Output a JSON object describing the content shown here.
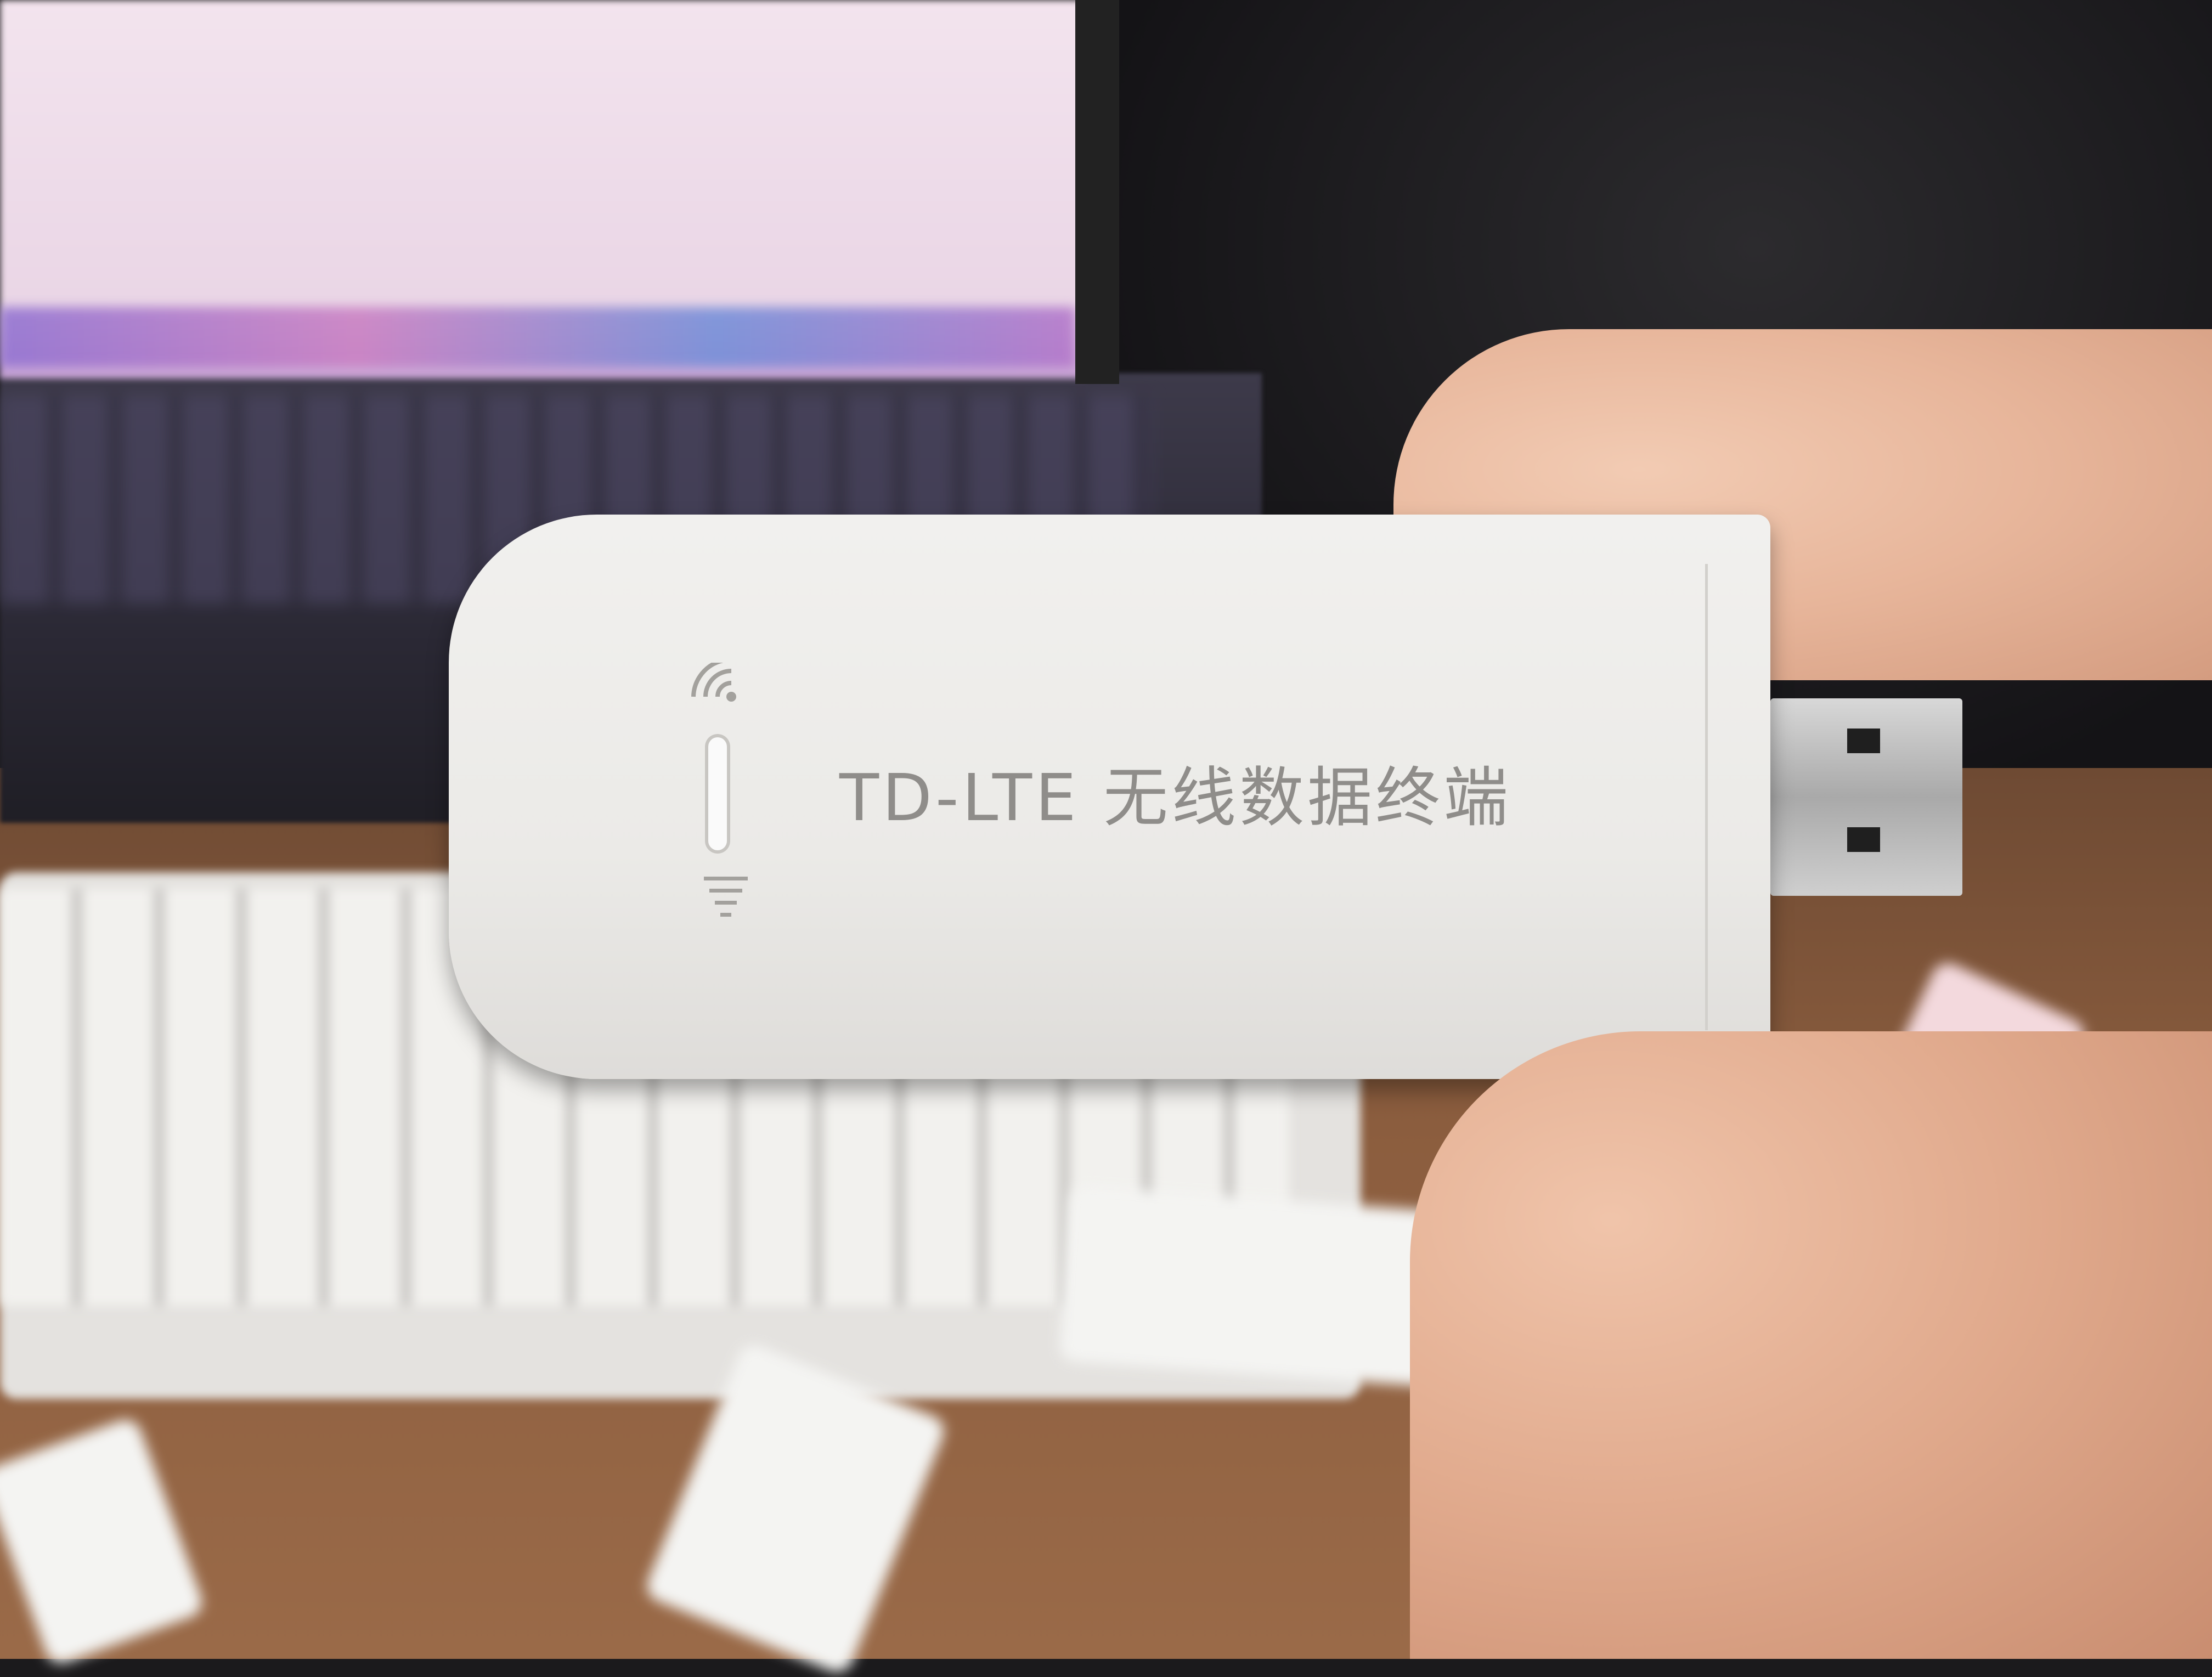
{
  "device": {
    "label": "TD-LTE 无线数据终端",
    "icons": [
      "wifi-icon",
      "signal-bars-icon",
      "led-indicator"
    ]
  },
  "colors": {
    "dongle_body": "#ebeae7",
    "label_text": "#8f8d8a",
    "desk": "#8b5d3e",
    "skin": "#e7b59a"
  }
}
